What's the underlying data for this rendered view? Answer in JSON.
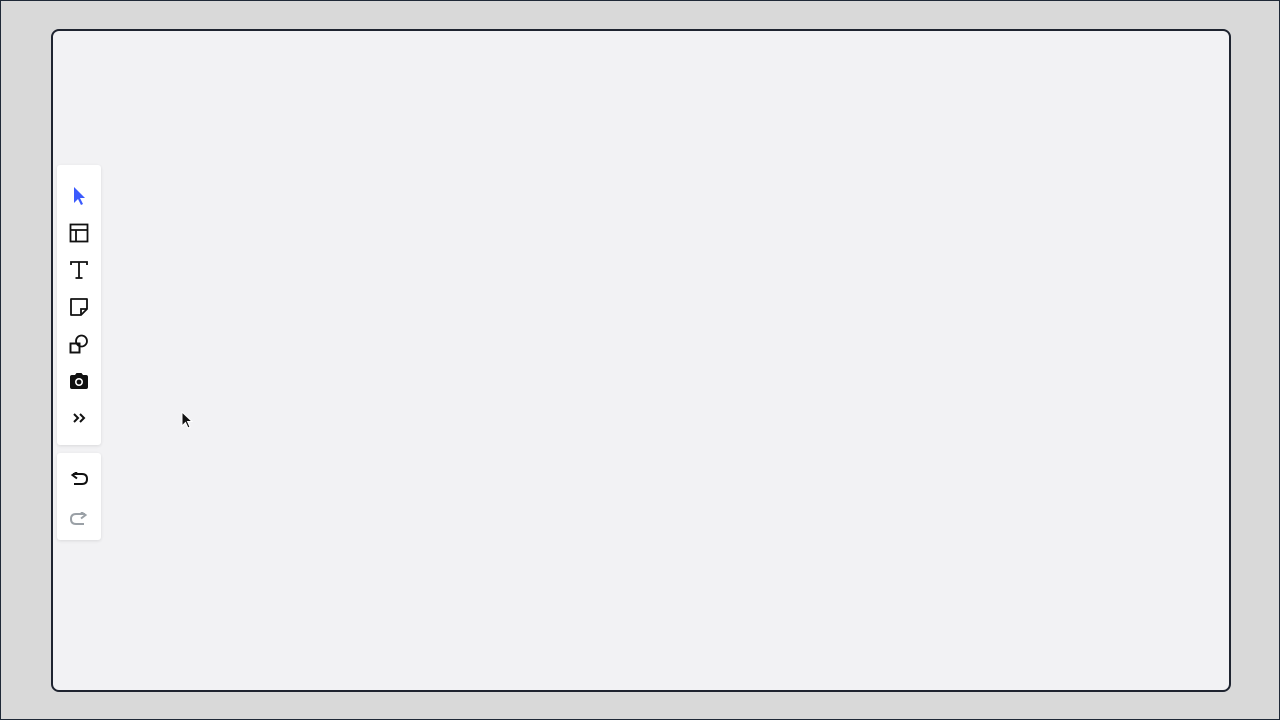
{
  "tools": [
    {
      "name": "select-tool",
      "icon": "pointer-icon",
      "active": true
    },
    {
      "name": "frame-tool",
      "icon": "layout-icon"
    },
    {
      "name": "text-tool",
      "icon": "text-icon"
    },
    {
      "name": "sticky-note-tool",
      "icon": "sticky-note-icon"
    },
    {
      "name": "shapes-tool",
      "icon": "shapes-icon"
    },
    {
      "name": "capture-tool",
      "icon": "camera-icon"
    },
    {
      "name": "more-tools",
      "icon": "chevrons-right-icon"
    }
  ],
  "history": [
    {
      "name": "undo-button",
      "icon": "undo-icon",
      "enabled": true
    },
    {
      "name": "redo-button",
      "icon": "redo-icon",
      "enabled": false
    }
  ],
  "colors": {
    "accent": "#3b5bfd",
    "icon": "#111111",
    "disabled_icon": "#9aa0a6",
    "canvas": "#f2f2f4",
    "frame_border": "#1f2430",
    "background": "#d9d9d9"
  }
}
